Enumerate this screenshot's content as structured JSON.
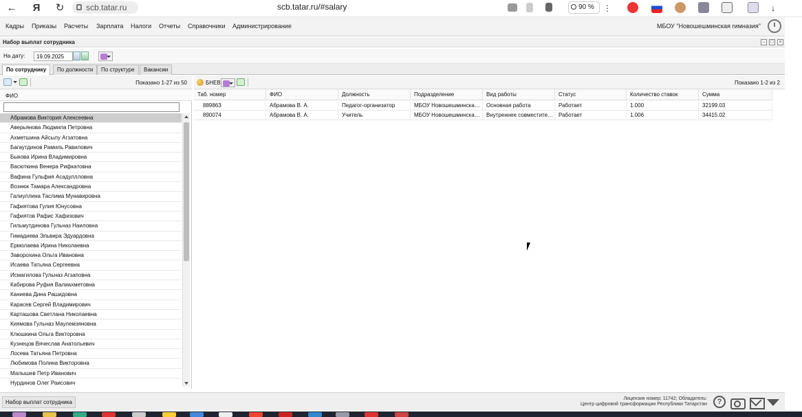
{
  "browser": {
    "url_pill": "scb.tatar.ru",
    "url_full": "scb.tatar.ru/#salary",
    "zoom": "90 %",
    "back_icon": "arrow-left-icon",
    "reload_icon": "reload-icon"
  },
  "menu": {
    "items": [
      "Кадры",
      "Приказы",
      "Расчеты",
      "Зарплата",
      "Налоги",
      "Отчеты",
      "Справочники",
      "Администрирование"
    ],
    "org": "МБОУ \"Новошешминская гимназия\""
  },
  "window": {
    "title": "Набор выплат сотрудника"
  },
  "date": {
    "label": "На дату:",
    "value": "19.09.2025"
  },
  "tabs": [
    "По сотруднику",
    "По должности",
    "По структуре",
    "Вакансии"
  ],
  "left": {
    "shown": "Показано 1-27 из 50",
    "column": "ФИО",
    "filter_value": "",
    "names": [
      "Абрамова Виктория Алексеевна",
      "Аверьянова Людмила Петровна",
      "Ахметшина Айсылу Агзатовна",
      "Багаутдинов Рамиль Равилович",
      "Быкова Ирина Владимировна",
      "Васюткина Венера Рифкатовна",
      "Вафина Гульфия Асадуллловна",
      "Вознюк Тамара Александровна",
      "Галиуллина Таслима Мунавировна",
      "Гафиятова Гулия Юнусовна",
      "Гафиятов Рафис Хафизович",
      "Гильмутдинова Гульназ Наиловна",
      "Гимадиева Эльвира Эдуардовна",
      "Ермолаева Ирина Николаевна",
      "Заворохина Ольга Ивановна",
      "Исаева Татьяна Сергеевна",
      "Исмагилова Гульназ Агзаповна",
      "Кабирова Руфия Валиахметовна",
      "Каниева Дина Рашидовна",
      "Карасев Сергей Владимирович",
      "Карташова Светлана Николаевна",
      "Киямова Гульназ Маулемзяновна",
      "Клюшкина Ольга Викторовна",
      "Кузнецов Вячеслав Анатольевич",
      "Лосева Татьяна Петровна",
      "Любимова Полина Викторовна",
      "Малышев Петр Иванович",
      "Нурдинов Олег Раисович"
    ]
  },
  "right": {
    "bnev_label": "БНЕВ",
    "shown": "Показано 1-2 из 2",
    "columns": [
      "Таб. номер",
      "ФИО",
      "Должность",
      "Подразделение",
      "Вид работы",
      "Статус",
      "Количество ставок",
      "Сумма"
    ],
    "rows": [
      [
        "889863",
        "Абрамова В. А.",
        "Педагог-организатор",
        "МБОУ Новошешминская г...",
        "Основная работа",
        "Работает",
        "1.000",
        "32199.03"
      ],
      [
        "890074",
        "Абрамова В. А.",
        "Учитель",
        "МБОУ Новошешминская г...",
        "Внутреннее совместитель...",
        "Работает",
        "1.006",
        "34415.02"
      ]
    ]
  },
  "status": {
    "task_label": "Набор выплат сотрудника",
    "license_line1": "Лицензия номер: 11742; Обладатель:",
    "license_line2": "Центр цифровой трансформации Республики Татарстан"
  }
}
